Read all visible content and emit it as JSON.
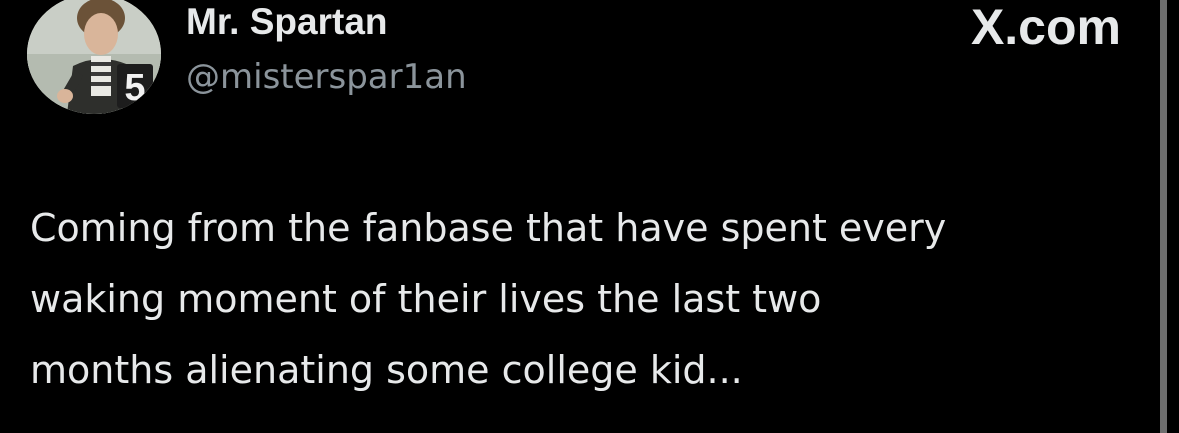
{
  "author": {
    "display_name": "Mr. Spartan",
    "handle": "@misterspar1an",
    "avatar_badge": "5"
  },
  "brand": {
    "label": "X.com",
    "icon": "x-logo-icon"
  },
  "tweet": {
    "lines": [
      "Coming from the fanbase that have spent every",
      "waking moment of their lives the last two",
      "months alienating some college kid..."
    ]
  },
  "colors": {
    "background": "#000000",
    "primary_text": "#e7e9ea",
    "secondary_text": "#8b949b"
  }
}
